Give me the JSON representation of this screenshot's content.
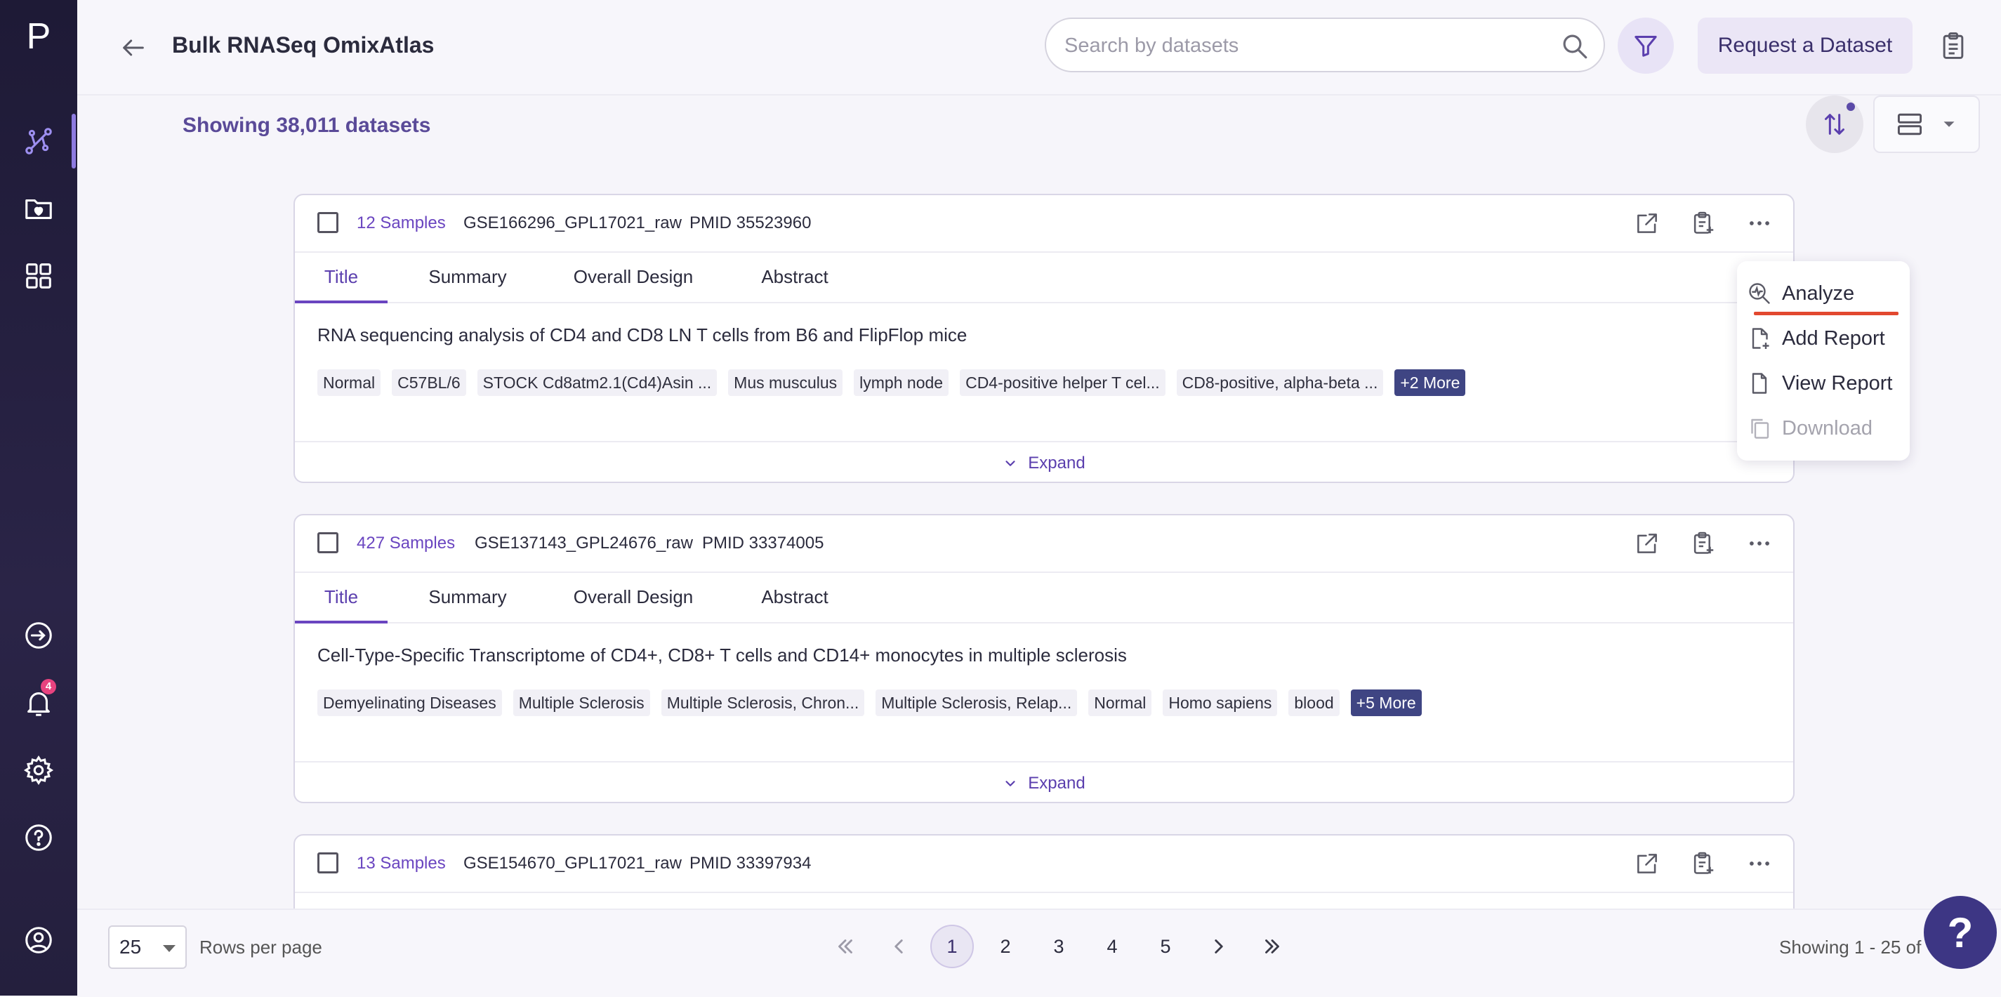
{
  "app": {
    "logo_letter": "P",
    "notification_count": "4"
  },
  "header": {
    "title": "Bulk RNASeq OmixAtlas",
    "search_placeholder": "Search by datasets",
    "request_label": "Request a Dataset"
  },
  "toolbar": {
    "showing": "Showing 38,011 datasets"
  },
  "tabs": [
    "Title",
    "Summary",
    "Overall Design",
    "Abstract"
  ],
  "expand_label": "Expand",
  "datasets": [
    {
      "samples": "12 Samples",
      "id": "GSE166296_GPL17021_raw",
      "pmid": "PMID 35523960",
      "title": "RNA sequencing analysis of CD4 and CD8 LN T cells from B6 and FlipFlop mice",
      "tags": [
        "Normal",
        "C57BL/6",
        "STOCK Cd8atm2.1(Cd4)Asin ...",
        "Mus musculus",
        "lymph node",
        "CD4-positive helper T cel...",
        "CD8-positive, alpha-beta ..."
      ],
      "more": "+2 More"
    },
    {
      "samples": "427 Samples",
      "id": "GSE137143_GPL24676_raw",
      "pmid": "PMID 33374005",
      "title": "Cell-Type-Specific Transcriptome of CD4+, CD8+ T cells and CD14+ monocytes in multiple sclerosis",
      "tags": [
        "Demyelinating Diseases",
        "Multiple Sclerosis",
        "Multiple Sclerosis, Chron...",
        "Multiple Sclerosis, Relap...",
        "Normal",
        "Homo sapiens",
        "blood"
      ],
      "more": "+5 More"
    },
    {
      "samples": "13 Samples",
      "id": "GSE154670_GPL17021_raw",
      "pmid": "PMID 33397934"
    }
  ],
  "menu": {
    "items": [
      {
        "label": "Analyze",
        "icon": "analyze-icon"
      },
      {
        "label": "Add Report",
        "icon": "add-report-icon"
      },
      {
        "label": "View Report",
        "icon": "view-report-icon"
      },
      {
        "label": "Download",
        "icon": "download-icon",
        "disabled": true
      }
    ]
  },
  "footer": {
    "rows_per_page_value": "25",
    "rows_per_page_label": "Rows per page",
    "pages": [
      "1",
      "2",
      "3",
      "4",
      "5"
    ],
    "current_page": "1",
    "showing_range": "Showing 1 - 25 of"
  },
  "colors": {
    "accent": "#6a45c0",
    "rail": "#1e1a36",
    "more_chip": "#3f4583",
    "analyze_underline": "#e2482f",
    "help_fab": "#3d3684"
  }
}
